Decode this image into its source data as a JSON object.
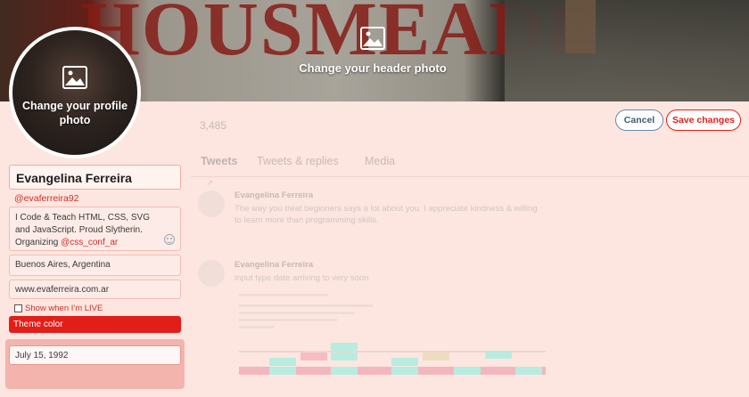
{
  "header": {
    "change_photo_label": "Change your header photo",
    "background_lettering": "HOUSMEADE"
  },
  "avatar": {
    "change_photo_label": "Change your profile photo"
  },
  "actions": {
    "cancel_label": "Cancel",
    "save_label": "Save changes"
  },
  "profile": {
    "stat_count": "3,485",
    "tabs": [
      {
        "label": "Tweets",
        "active": true
      },
      {
        "label": "Tweets & replies",
        "active": false
      },
      {
        "label": "Media",
        "active": false
      }
    ]
  },
  "tweets": [
    {
      "author": "Evangelina Ferreira",
      "text": "The way you treat beginners says a lot about you. I appreciate kindness & willing to learn more than programming skills."
    },
    {
      "author": "Evangelina Ferreira",
      "text": "input type date arriving to             very soon"
    }
  ],
  "edit_form": {
    "name": "Evangelina Ferreira",
    "handle": "@evaferreira92",
    "bio_text": "I Code & Teach HTML, CSS, SVG and JavaScript. Proud Slytherin. Organizing ",
    "bio_mention": "@css_conf_ar",
    "location": "Buenos Aires, Argentina",
    "website": "www.evaferreira.com.ar",
    "show_live_label": "Show when I'm LIVE",
    "show_live_checked": false,
    "theme_color_label": "Theme color",
    "birth_date": "July 15, 1992"
  },
  "colors": {
    "accent": "#e21e19",
    "page_background": "#fde6e0"
  }
}
